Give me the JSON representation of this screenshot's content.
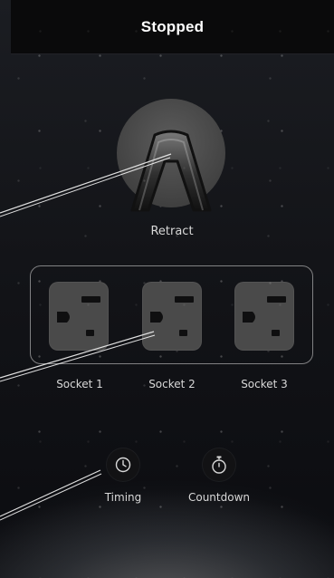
{
  "header": {
    "title": "Stopped"
  },
  "retract": {
    "label": "Retract",
    "icon": "retract-arch-icon"
  },
  "sockets": [
    {
      "label": "Socket 1",
      "icon": "outlet-icon"
    },
    {
      "label": "Socket 2",
      "icon": "outlet-icon"
    },
    {
      "label": "Socket 3",
      "icon": "outlet-icon"
    }
  ],
  "actions": {
    "timing": {
      "label": "Timing",
      "icon": "clock-icon"
    },
    "countdown": {
      "label": "Countdown",
      "icon": "stopwatch-icon"
    }
  },
  "colors": {
    "background": "#0b0c10",
    "header": "#0a0a0b",
    "socket_fill": "#4a4a4a",
    "text": "#d8d8d8"
  }
}
